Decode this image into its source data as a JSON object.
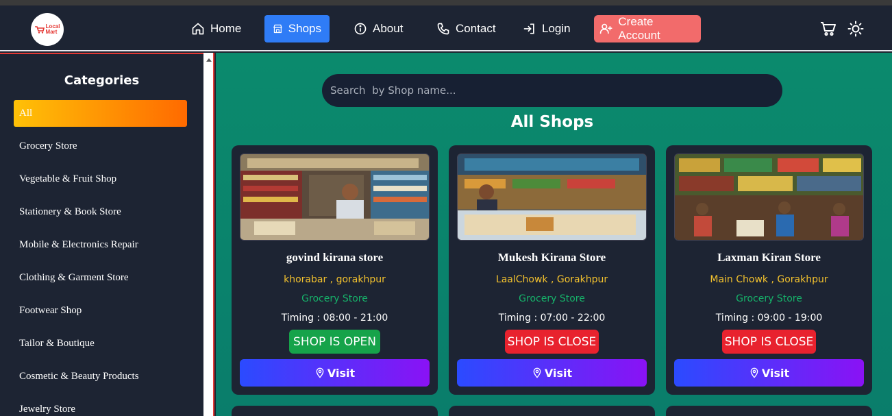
{
  "brand": {
    "line1": "Local",
    "line2": "Mart"
  },
  "nav": {
    "home": "Home",
    "shops": "Shops",
    "about": "About",
    "contact": "Contact",
    "login": "Login",
    "create_account": "Create Account"
  },
  "sidebar": {
    "title": "Categories",
    "items": [
      "All",
      "Grocery Store",
      "Vegetable & Fruit Shop",
      "Stationery & Book Store",
      "Mobile & Electronics Repair",
      "Clothing & Garment Store",
      "Footwear Shop",
      "Tailor & Boutique",
      "Cosmetic & Beauty Products",
      "Jewelry Store"
    ]
  },
  "search": {
    "placeholder": "Search  by Shop name..."
  },
  "main": {
    "title": "All Shops"
  },
  "shops": [
    {
      "name": "govind kirana store",
      "location": "khorabar , gorakhpur",
      "category": "Grocery Store",
      "timing": "Timing : 08:00 - 21:00",
      "status": "SHOP IS OPEN",
      "visit": "Visit"
    },
    {
      "name": "Mukesh Kirana Store",
      "location": "LaalChowk , Gorakhpur",
      "category": "Grocery Store",
      "timing": "Timing : 07:00 - 22:00",
      "status": "SHOP IS CLOSE",
      "visit": "Visit"
    },
    {
      "name": "Laxman Kiran Store",
      "location": "Main Chowk , Gorakhpur",
      "category": "Grocery Store",
      "timing": "Timing : 09:00 - 19:00",
      "status": "SHOP IS CLOSE",
      "visit": "Visit"
    }
  ],
  "colors": {
    "navbar_bg": "#1d2433",
    "active_nav": "#2f7cf6",
    "create_account": "#f26b6b",
    "main_bg": "#0b8a6d",
    "open_status": "#16a34a",
    "close_status": "#e8222e"
  }
}
